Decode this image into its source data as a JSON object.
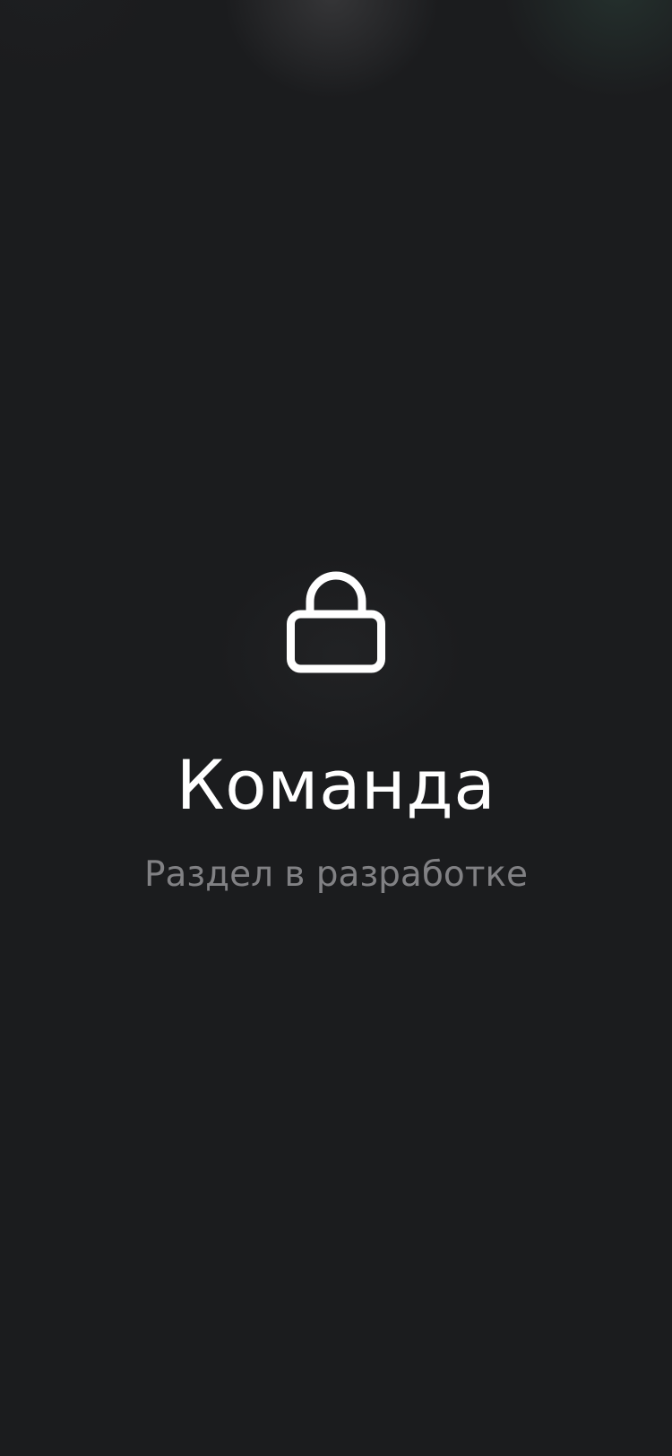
{
  "screen": {
    "title": "Команда",
    "subtitle": "Раздел в разработке",
    "icon": "lock-icon"
  },
  "colors": {
    "background": "#1b1c1e",
    "title": "#ffffff",
    "subtitle": "#818184",
    "icon": "#ffffff"
  }
}
